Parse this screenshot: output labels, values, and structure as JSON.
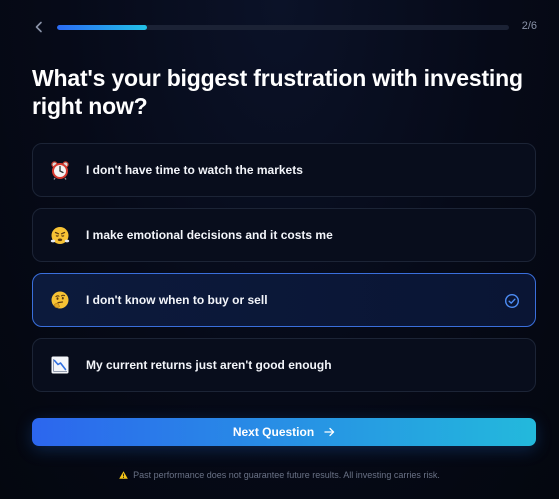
{
  "header": {
    "back_icon": "chevron-left-icon",
    "progress": 0.2,
    "step_text": "2/6"
  },
  "question": {
    "title": "What's your biggest frustration with investing right now?"
  },
  "options": [
    {
      "icon": "alarm-clock-icon",
      "label": "I don't have time to watch the markets",
      "selected": false
    },
    {
      "icon": "steaming-face-icon",
      "label": "I make emotional decisions and it costs me",
      "selected": false
    },
    {
      "icon": "thinking-face-icon",
      "label": "I don't know when to buy or sell",
      "selected": true
    },
    {
      "icon": "chart-decreasing-icon",
      "label": "My current returns just aren't good enough",
      "selected": false
    }
  ],
  "next_button": {
    "label": "Next Question",
    "icon": "arrow-right-icon"
  },
  "disclaimer": {
    "icon": "warning-icon",
    "text": "Past performance does not guarantee future results. All investing carries risk."
  },
  "colors": {
    "accent_start": "#2c66ee",
    "accent_end": "#23b9dc",
    "selected_border": "#3a6fdc",
    "background": "#060a18",
    "warning": "#f5c518"
  }
}
